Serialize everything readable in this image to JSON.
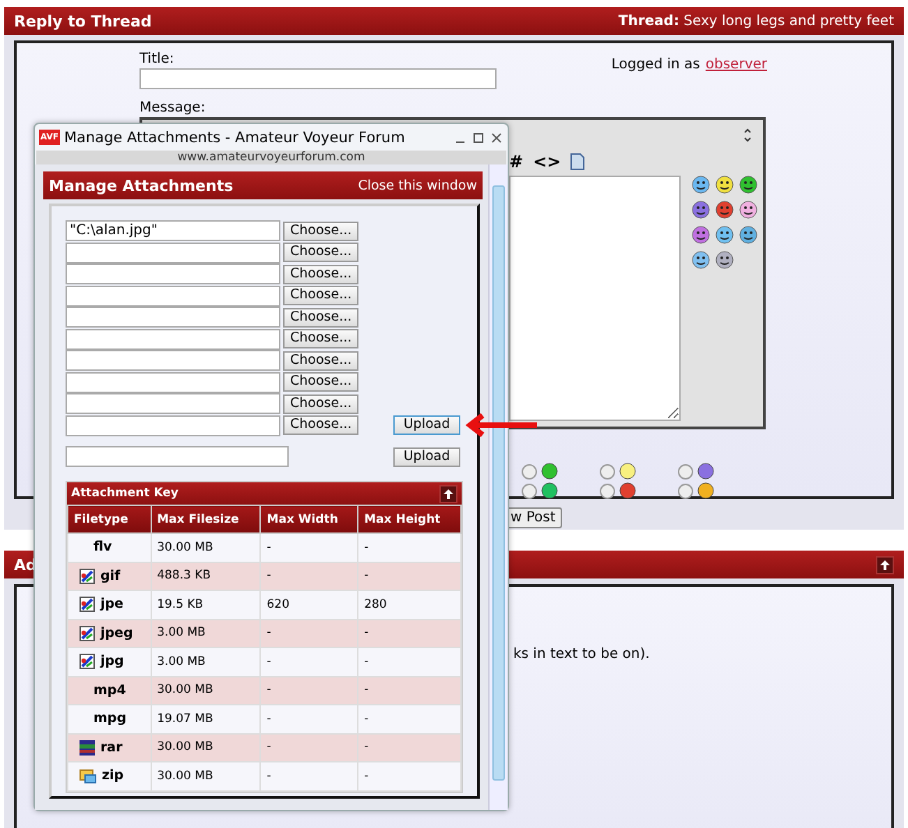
{
  "header": {
    "title": "Reply to Thread",
    "thread_label": "Thread:",
    "thread_title": "Sexy long legs and pretty feet"
  },
  "form": {
    "title_label": "Title:",
    "logged_in": "Logged in as",
    "username": "observer",
    "message_label": "Message:",
    "toolbar_symbols": [
      "#",
      "<>"
    ],
    "post_button": "w Post"
  },
  "post_icons": [
    {
      "checked": false
    },
    {
      "checked": false
    },
    {
      "checked": false
    },
    {
      "checked": false
    },
    {
      "checked": false
    },
    {
      "checked": false
    }
  ],
  "second_section": {
    "title": "Ad",
    "note": "ks in text to be on)."
  },
  "popup": {
    "title": "Manage Attachments - Amateur Voyeur Forum",
    "logo": "AVF",
    "url": "www.amateurvoyeurforum.com",
    "heading": "Manage Attachments",
    "close_link": "Close this window",
    "file_fields": [
      {
        "value": "\"C:\\alan.jpg\"",
        "button": "Choose..."
      },
      {
        "button": "Choose..."
      },
      {
        "button": "Choose..."
      },
      {
        "button": "Choose..."
      },
      {
        "button": "Choose..."
      },
      {
        "button": "Choose..."
      },
      {
        "button": "Choose..."
      },
      {
        "button": "Choose..."
      },
      {
        "button": "Choose..."
      },
      {
        "button": "Choose..."
      }
    ],
    "upload_button": "Upload",
    "url_upload_button": "Upload"
  },
  "attachment_key": {
    "title": "Attachment Key",
    "columns": [
      "Filetype",
      "Max Filesize",
      "Max Width",
      "Max Height"
    ],
    "rows": [
      {
        "kind": "plain",
        "cells": [
          "flv",
          "30.00 MB",
          "-",
          "-"
        ]
      },
      {
        "kind": "image",
        "cells": [
          "gif",
          "488.3 KB",
          "-",
          "-"
        ]
      },
      {
        "kind": "image",
        "cells": [
          "jpe",
          "19.5 KB",
          "620",
          "280"
        ]
      },
      {
        "kind": "image",
        "cells": [
          "jpeg",
          "3.00 MB",
          "-",
          "-"
        ]
      },
      {
        "kind": "image",
        "cells": [
          "jpg",
          "3.00 MB",
          "-",
          "-"
        ]
      },
      {
        "kind": "plain",
        "cells": [
          "mp4",
          "30.00 MB",
          "-",
          "-"
        ]
      },
      {
        "kind": "plain",
        "cells": [
          "mpg",
          "19.07 MB",
          "-",
          "-"
        ]
      },
      {
        "kind": "archive",
        "cells": [
          "rar",
          "30.00 MB",
          "-",
          "-"
        ]
      },
      {
        "kind": "zip",
        "cells": [
          "zip",
          "30.00 MB",
          "-",
          "-"
        ]
      }
    ]
  }
}
